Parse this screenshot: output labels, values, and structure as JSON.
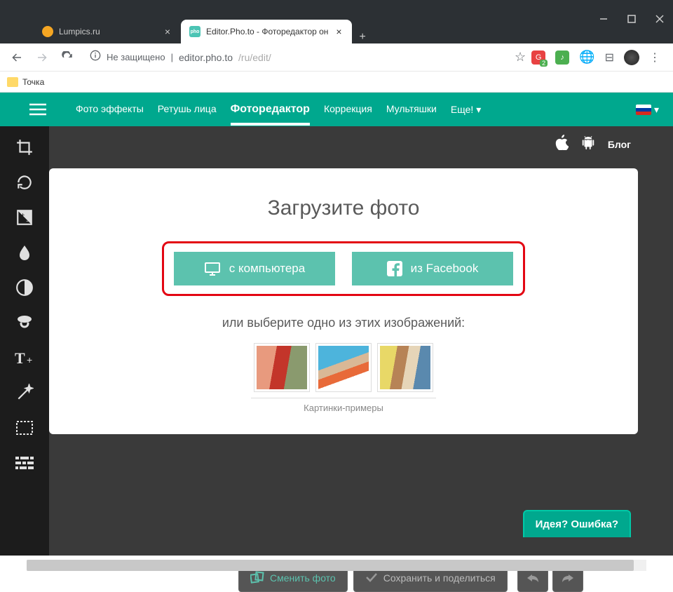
{
  "browser": {
    "tabs": [
      {
        "title": "Lumpics.ru",
        "favicon": "orange"
      },
      {
        "title": "Editor.Pho.to - Фоторедактор он",
        "favicon": "phto",
        "active": true
      }
    ],
    "address": {
      "security": "Не защищено",
      "host": "editor.pho.to",
      "path": "/ru/edit/"
    },
    "bookmark": "Точка"
  },
  "nav": {
    "items": [
      "Фото эффекты",
      "Ретушь лица",
      "Фоторедактор",
      "Коррекция",
      "Мультяшки"
    ],
    "more": "Еще!",
    "active_index": 2
  },
  "top_links": {
    "blog": "Блог"
  },
  "upload": {
    "title": "Загрузите фото",
    "from_computer": "с компьютера",
    "from_facebook": "из Facebook",
    "or_text": "или выберите одно из этих изображений:",
    "samples_caption": "Картинки-примеры"
  },
  "bottom": {
    "change_photo": "Сменить фото",
    "save_share": "Сохранить и поделиться"
  },
  "feedback": "Идея? Ошибка?",
  "tools": [
    "crop",
    "rotate",
    "exposure",
    "color-drop",
    "contrast",
    "sticker",
    "text",
    "magic",
    "frame",
    "pattern"
  ]
}
